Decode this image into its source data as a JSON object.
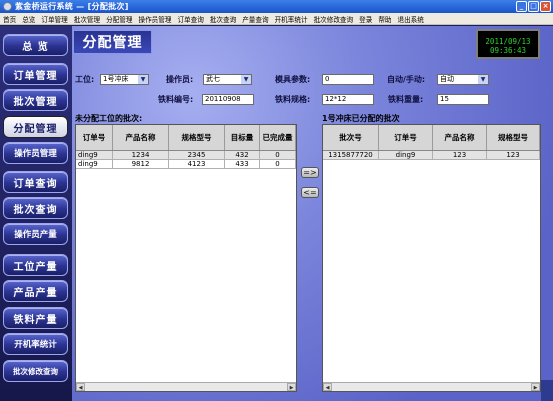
{
  "window": {
    "title": "紫金桥运行系统 — [分配批次]",
    "buttons": {
      "minimize": "_",
      "maximize": "□",
      "close": "×"
    }
  },
  "menu": [
    "首页",
    "总览",
    "订单管理",
    "批次管理",
    "分配管理",
    "操作员管理",
    "订单查询",
    "批次查询",
    "产量查询",
    "开机率统计",
    "批次修改查询",
    "登录",
    "帮助",
    "退出系统"
  ],
  "sidebar": {
    "items": [
      {
        "label": "总 览",
        "active": false
      },
      {
        "label": "订单管理",
        "active": false
      },
      {
        "label": "批次管理",
        "active": false
      },
      {
        "label": "分配管理",
        "active": true
      },
      {
        "label": "操作员管理",
        "active": false
      },
      {
        "label": "订单查询",
        "active": false
      },
      {
        "label": "批次查询",
        "active": false
      },
      {
        "label": "操作员产量",
        "active": false
      },
      {
        "label": "工位产量",
        "active": false
      },
      {
        "label": "产品产量",
        "active": false
      },
      {
        "label": "铁料产量",
        "active": false
      },
      {
        "label": "开机率统计",
        "active": false
      },
      {
        "label": "批次修改查询",
        "active": false
      }
    ]
  },
  "page": {
    "title": "分配管理",
    "clock": {
      "date": "2011/09/13",
      "time": "09:36:43"
    }
  },
  "form": {
    "station_label": "工位:",
    "station_value": "1号冲床",
    "operator_label": "操作员:",
    "operator_value": "武七",
    "die_param_label": "模具参数:",
    "die_param_value": "0",
    "mode_label": "自动/手动:",
    "mode_value": "自动",
    "iron_no_label": "铁料编号:",
    "iron_no_value": "20110908",
    "iron_spec_label": "铁料规格:",
    "iron_spec_value": "12*12",
    "iron_weight_label": "铁料重量:",
    "iron_weight_value": "15"
  },
  "unassigned": {
    "title": "未分配工位的批次:",
    "columns": [
      "订单号",
      "产品名称",
      "规格型号",
      "目标量",
      "已完成量"
    ],
    "rows": [
      [
        "ding9",
        "1234",
        "2345",
        "432",
        "0"
      ],
      [
        "ding9",
        "9812",
        "4123",
        "433",
        "0"
      ]
    ]
  },
  "assigned": {
    "title": "1号冲床已分配的批次",
    "columns": [
      "批次号",
      "订单号",
      "产品名称",
      "规格型号"
    ],
    "rows": [
      [
        "1315877720",
        "ding9",
        "123",
        "123"
      ]
    ]
  },
  "actions": {
    "assign": "=>",
    "unassign": "<="
  },
  "icons": {
    "dropdown": "chevron-down-icon",
    "scroll_left": "arrow-left-icon",
    "scroll_right": "arrow-right-icon"
  }
}
